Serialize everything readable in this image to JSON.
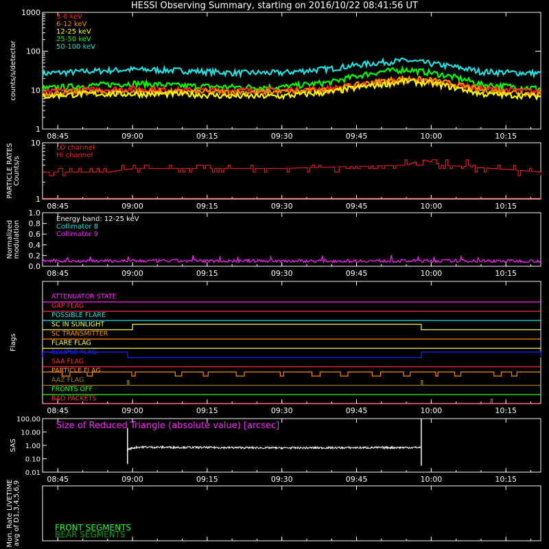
{
  "title": "HESSI Observing Summary, starting on 2016/10/22 08:41:56 UT",
  "time_ticks": [
    "08:45",
    "09:00",
    "09:15",
    "09:30",
    "09:45",
    "10:00",
    "10:15"
  ],
  "colors": {
    "b36": "#ff2020",
    "b612": "#ff8c00",
    "b1225": "#ffff00",
    "b2550": "#00ff00",
    "b50100": "#20e0e0",
    "magenta": "#ff20ff",
    "frame": "#ffffff",
    "red": "#ff2020",
    "cyan": "#20e0e0",
    "green": "#20ff20",
    "dark_green": "#00a000"
  },
  "chart_data": [
    {
      "type": "line",
      "panel": "count_rates",
      "ylabel": "counts/s/detector",
      "yscale": "log",
      "ylim": [
        1,
        1000
      ],
      "yticks": [
        "1",
        "10",
        "100",
        "1000"
      ],
      "xlim": [
        "08:41:56",
        "10:22:00"
      ],
      "legend": [
        "3-6 keV",
        "6-12 keV",
        "12-25 keV",
        "25-50 keV",
        "50-100 keV"
      ],
      "series": [
        {
          "name": "50-100 keV",
          "color": "b50100",
          "x": [
            "08:42",
            "08:50",
            "09:00",
            "09:10",
            "09:20",
            "09:30",
            "09:40",
            "09:50",
            "09:55",
            "10:00",
            "10:10",
            "10:22"
          ],
          "values": [
            27,
            30,
            34,
            32,
            28,
            28,
            36,
            52,
            58,
            48,
            30,
            27
          ]
        },
        {
          "name": "25-50 keV",
          "color": "b2550",
          "x": [
            "08:42",
            "08:50",
            "09:00",
            "09:10",
            "09:20",
            "09:30",
            "09:40",
            "09:50",
            "09:55",
            "10:00",
            "10:10",
            "10:22"
          ],
          "values": [
            11,
            13,
            15,
            13,
            12,
            12,
            16,
            30,
            34,
            28,
            14,
            11
          ]
        },
        {
          "name": "3-6 keV",
          "color": "b36",
          "x": [
            "08:42",
            "08:50",
            "09:00",
            "09:10",
            "09:20",
            "09:30",
            "09:40",
            "09:50",
            "09:55",
            "10:00",
            "10:10",
            "10:22"
          ],
          "values": [
            9,
            10,
            11,
            10,
            10,
            10,
            11,
            16,
            18,
            16,
            11,
            9
          ]
        },
        {
          "name": "6-12 keV",
          "color": "b612",
          "x": [
            "08:42",
            "08:50",
            "09:00",
            "09:10",
            "09:20",
            "09:30",
            "09:40",
            "09:50",
            "09:55",
            "10:00",
            "10:10",
            "10:22"
          ],
          "values": [
            8,
            9,
            9,
            9,
            9,
            9,
            10,
            17,
            20,
            18,
            10,
            8
          ]
        },
        {
          "name": "12-25 keV",
          "color": "b1225",
          "x": [
            "08:42",
            "08:50",
            "09:00",
            "09:10",
            "09:20",
            "09:30",
            "09:40",
            "09:50",
            "09:55",
            "10:00",
            "10:10",
            "10:22"
          ],
          "values": [
            7,
            8,
            8,
            8,
            7,
            7,
            9,
            14,
            17,
            15,
            8,
            7
          ]
        }
      ]
    },
    {
      "type": "line",
      "panel": "particle_rates",
      "ylabel": "PARTICLE RATES\nCounts/s",
      "yscale": "log",
      "ylim": [
        1,
        10
      ],
      "yticks": [
        "1",
        "10"
      ],
      "legend": [
        "LO channel",
        "HI channel"
      ],
      "series": [
        {
          "name": "LO channel",
          "color": "red",
          "x": [
            "08:42",
            "08:55",
            "09:00",
            "09:30",
            "09:55",
            "09:58",
            "10:02",
            "10:22"
          ],
          "values": [
            3,
            3,
            3.5,
            3.5,
            4,
            5,
            4,
            3
          ]
        }
      ]
    },
    {
      "type": "line",
      "panel": "modulation",
      "ylabel": "Normalized\nmodulation",
      "ylim": [
        0,
        1.0
      ],
      "yticks": [
        "0.0",
        "0.2",
        "0.4",
        "0.6",
        "0.8",
        "1.0"
      ],
      "annotation": "Energy band: 12-25 keV",
      "legend": [
        "Collimator 8",
        "Collimator 9"
      ],
      "series": [
        {
          "name": "Collimator 9",
          "color": "magenta",
          "x": [
            "08:42",
            "10:22"
          ],
          "values": [
            0.1,
            0.1
          ]
        }
      ]
    },
    {
      "type": "line",
      "panel": "flags",
      "ylabel": "Flags",
      "flags": [
        {
          "label": "ATTENUATOR STATE",
          "color": "#ff20ff"
        },
        {
          "label": "GAP FLAG",
          "color": "#ff3030"
        },
        {
          "label": "POSSIBLE FLARE",
          "color": "#20e0e0"
        },
        {
          "label": "SC IN SUNLIGHT",
          "color": "#ffff40",
          "high": [
            [
              "09:00",
              "09:58"
            ]
          ]
        },
        {
          "label": "SC TRANSMITTER",
          "color": "#ff8c00"
        },
        {
          "label": "FLARE FLAG",
          "color": "#ffff40"
        },
        {
          "label": "ECLIPSE FLAG",
          "color": "#2020ff",
          "high": [
            [
              "08:42",
              "08:59"
            ],
            [
              "09:58",
              "10:22"
            ]
          ]
        },
        {
          "label": "SAA FLAG",
          "color": "#ff3030"
        },
        {
          "label": "PARTICLE FLAG",
          "color": "#ff8c00",
          "pulses": true
        },
        {
          "label": "AAZ FLAG",
          "color": "#a08020",
          "spikes": [
            "08:59",
            "09:58"
          ]
        },
        {
          "label": "FRONTS OFF",
          "color": "#20ff20"
        },
        {
          "label": "BAD PACKETS",
          "color": "#ff3030",
          "spikes": [
            "10:12"
          ]
        }
      ]
    },
    {
      "type": "line",
      "panel": "sas",
      "ylabel": "SAS",
      "yscale": "log",
      "ylim": [
        0.01,
        100
      ],
      "yticks": [
        "0.01",
        "0.10",
        "1.00",
        "10.00",
        "100.00"
      ],
      "annotation": "Size of Reduced Triangle (absolute value) [arcsec]",
      "series": [
        {
          "name": "",
          "color": "frame",
          "x": [
            "08:59",
            "09:00",
            "09:30",
            "09:58"
          ],
          "values": [
            0.4,
            0.7,
            0.65,
            0.7
          ]
        }
      ]
    },
    {
      "type": "line",
      "panel": "livetime",
      "ylabel": "Mon. Rate LIVETIME\navg of D1,3,4,5,6,9",
      "legend": [
        "FRONT SEGMENTS",
        "REAR SEGMENTS"
      ]
    }
  ]
}
